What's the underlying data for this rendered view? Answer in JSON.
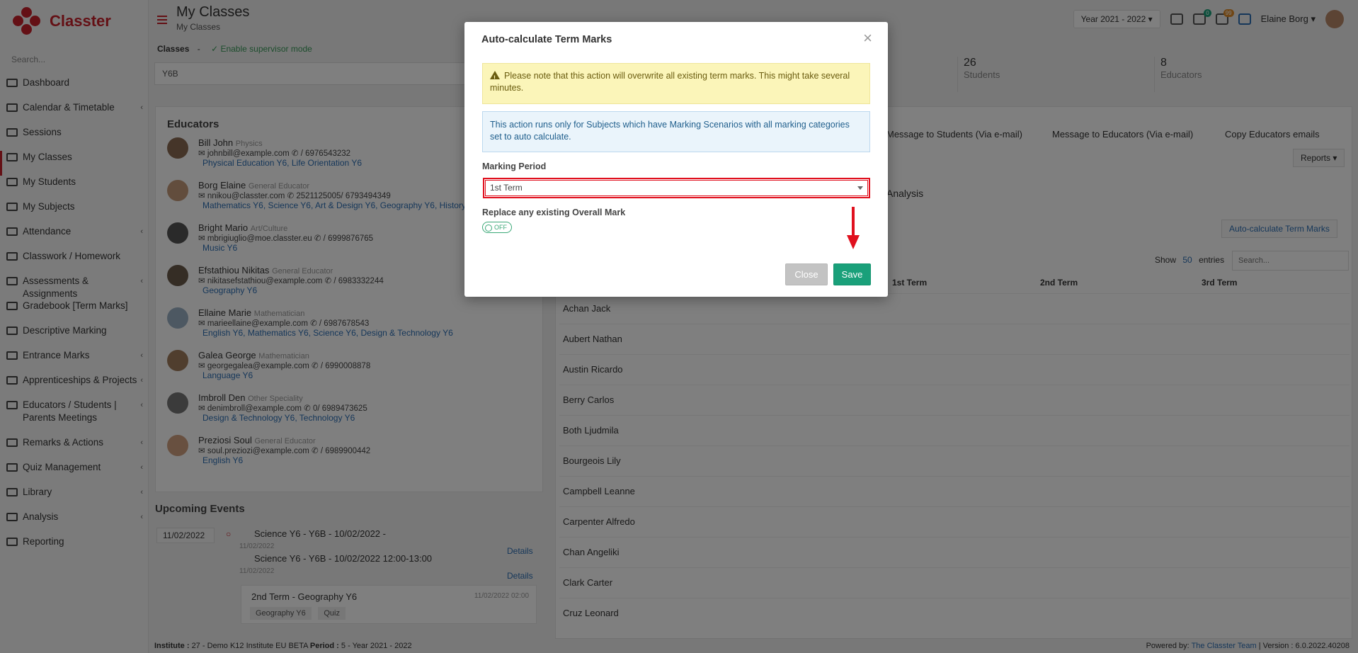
{
  "app": {
    "name": "Classter",
    "search_placeholder": "Search..."
  },
  "sidebar": {
    "items": [
      {
        "label": "Dashboard",
        "icon": "dashboard-icon",
        "chevron": false
      },
      {
        "label": "Calendar & Timetable",
        "icon": "calendar-icon",
        "chevron": true
      },
      {
        "label": "Sessions",
        "icon": "sessions-icon",
        "chevron": false
      },
      {
        "label": "My Classes",
        "icon": "classes-icon",
        "chevron": false,
        "active": true
      },
      {
        "label": "My Students",
        "icon": "students-icon",
        "chevron": false
      },
      {
        "label": "My Subjects",
        "icon": "subjects-icon",
        "chevron": false
      },
      {
        "label": "Attendance",
        "icon": "attendance-icon",
        "chevron": true
      },
      {
        "label": "Classwork / Homework",
        "icon": "homework-icon",
        "chevron": false
      },
      {
        "label": "Assessments & Assignments",
        "icon": "assessments-icon",
        "chevron": true
      },
      {
        "label": "Gradebook [Term Marks]",
        "icon": "gradebook-icon",
        "chevron": false
      },
      {
        "label": "Descriptive Marking",
        "icon": "descriptive-icon",
        "chevron": false
      },
      {
        "label": "Entrance Marks",
        "icon": "entrance-icon",
        "chevron": true
      },
      {
        "label": "Apprenticeships & Projects",
        "icon": "projects-icon",
        "chevron": true
      },
      {
        "label": "Educators / Students | Parents Meetings",
        "icon": "meetings-icon",
        "chevron": true
      },
      {
        "label": "Remarks & Actions",
        "icon": "remarks-icon",
        "chevron": true
      },
      {
        "label": "Quiz Management",
        "icon": "quiz-icon",
        "chevron": true
      },
      {
        "label": "Library",
        "icon": "library-icon",
        "chevron": true
      },
      {
        "label": "Analysis",
        "icon": "analysis-icon",
        "chevron": true
      },
      {
        "label": "Reporting",
        "icon": "reporting-icon",
        "chevron": false
      }
    ]
  },
  "header": {
    "title": "My Classes",
    "breadcrumb": "My Classes",
    "year": "Year 2021 - 2022",
    "badge_notifications": "0",
    "badge_messages": "99",
    "user": "Elaine Borg"
  },
  "classes": {
    "label": "Classes",
    "separator": "-",
    "supervisor": "✓ Enable supervisor mode",
    "selected": "Y6B"
  },
  "stats": [
    {
      "value": "26",
      "label": "Students"
    },
    {
      "value": "8",
      "label": "Educators"
    }
  ],
  "educators": {
    "title": "Educators",
    "list": [
      {
        "name": "Bill John",
        "role": "Physics",
        "contact": "✉ johnbill@example.com ✆ / 6976543232",
        "subjects": "Physical Education Y6, Life Orientation Y6"
      },
      {
        "name": "Borg Elaine",
        "role": "General Educator",
        "contact": "✉ nnikou@classter.com ✆ 2521125005/ 6793494349",
        "subjects": "Mathematics Y6, Science Y6, Art & Design Y6, Geography Y6, History Y"
      },
      {
        "name": "Bright Mario",
        "role": "Art/Culture",
        "contact": "✉ mbrigiuglio@moe.classter.eu ✆ / 6999876765",
        "subjects": "Music Y6"
      },
      {
        "name": "Efstathiou Nikitas",
        "role": "General Educator",
        "contact": "✉ nikitasefstathiou@example.com ✆ / 6983332244",
        "subjects": "Geography Y6"
      },
      {
        "name": "Ellaine Marie",
        "role": "Mathematician",
        "contact": "✉ marieellaine@example.com ✆ / 6987678543",
        "subjects": "English Y6, Mathematics Y6, Science Y6, Design & Technology Y6"
      },
      {
        "name": "Galea George",
        "role": "Mathematician",
        "contact": "✉ georgegalea@example.com ✆ / 6990008878",
        "subjects": "Language Y6"
      },
      {
        "name": "Imbroll Den",
        "role": "Other Speciality",
        "contact": "✉ denimbroll@example.com ✆ 0/ 6989473625",
        "subjects": "Design & Technology Y6, Technology Y6"
      },
      {
        "name": "Preziosi Soul",
        "role": "General Educator",
        "contact": "✉ soul.preziozi@example.com ✆ / 6989900442",
        "subjects": "English Y6"
      }
    ]
  },
  "events": {
    "title": "Upcoming Events",
    "date": "11/02/2022",
    "items": [
      {
        "text": "Science Y6 - Y6B - 10/02/2022 -",
        "small": "11/02/2022",
        "link": "Details"
      },
      {
        "text": "Science Y6 - Y6B - 10/02/2022 12:00-13:00",
        "small": "11/02/2022",
        "link": "Details"
      }
    ],
    "card": {
      "title": "2nd Term - Geography Y6",
      "time": "11/02/2022 02:00",
      "tags": [
        "Geography Y6",
        "Quiz"
      ]
    }
  },
  "actions": {
    "msg_students": "Message to Students (Via e-mail)",
    "msg_educators": "Message to Educators (Via e-mail)",
    "copy_emails": "Copy Educators emails",
    "reports": "Reports",
    "analysis_tab": "Analysis",
    "autocalc": "Auto-calculate Term Marks"
  },
  "table": {
    "show": "Show",
    "entries_count": "50",
    "entries": "entries",
    "search_placeholder": "Search...",
    "columns": [
      "1st Term",
      "2nd Term",
      "3rd Term"
    ],
    "students": [
      "Achan Jack",
      "Aubert Nathan",
      "Austin Ricardo",
      "Berry Carlos",
      "Both Ljudmila",
      "Bourgeois Lily",
      "Campbell Leanne",
      "Carpenter Alfredo",
      "Chan Angeliki",
      "Clark Carter",
      "Cruz Leonard"
    ]
  },
  "footer": {
    "institute_label": "Institute :",
    "institute_value": "27 - Demo K12 Institute EU BETA",
    "period_label": "Period :",
    "period_value": "5 - Year 2021 - 2022",
    "powered": "Powered by:",
    "team": "The Classter Team",
    "version": "| Version : 6.0.2022.40208"
  },
  "modal": {
    "title": "Auto-calculate Term Marks",
    "warning": "Please note that this action will overwrite all existing term marks. This might take several minutes.",
    "info": "This action runs only for Subjects which have Marking Scenarios with all marking categories set to auto calculate.",
    "marking_period_label": "Marking Period",
    "marking_period_value": "1st Term",
    "replace_label": "Replace any existing Overall Mark",
    "toggle_state": "OFF",
    "close_label": "Close",
    "save_label": "Save"
  },
  "colors": {
    "brand": "#c9202b",
    "save": "#1aa07a",
    "highlight": "#e0101e"
  }
}
